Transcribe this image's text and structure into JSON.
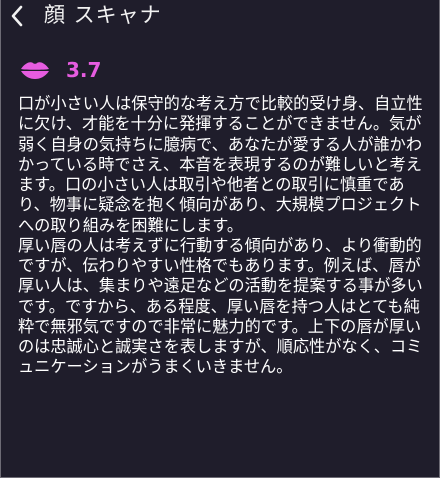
{
  "header": {
    "back_icon": "chevron-left-icon",
    "title": "顔 スキャナ"
  },
  "score": {
    "icon": "lips-icon",
    "value": "3.7",
    "accent_color": "#e65ce0"
  },
  "description": {
    "paragraphs": [
      "口が小さい人は保守的な考え方で比較的受け身、自立性に欠け、才能を十分に発揮することができません。気が弱く自身の気持ちに臆病で、あなたが愛する人が誰かわかっている時でさえ、本音を表現するのが難しいと考えます。口の小さい人は取引や他者との取引に慎重であり、物事に疑念を抱く傾向があり、大規模プロジェクトへの取り組みを困難にします。",
      "厚い唇の人は考えずに行動する傾向があり、より衝動的ですが、伝わりやすい性格でもあります。例えば、唇が厚い人は、集まりや遠足などの活動を提案する事が多いです。ですから、ある程度、厚い唇を持つ人はとても純粋で無邪気ですので非常に魅力的です。上下の唇が厚いのは忠誠心と誠実さを表しますが、順応性がなく、コミュニケーションがうまくいきません。"
    ]
  }
}
